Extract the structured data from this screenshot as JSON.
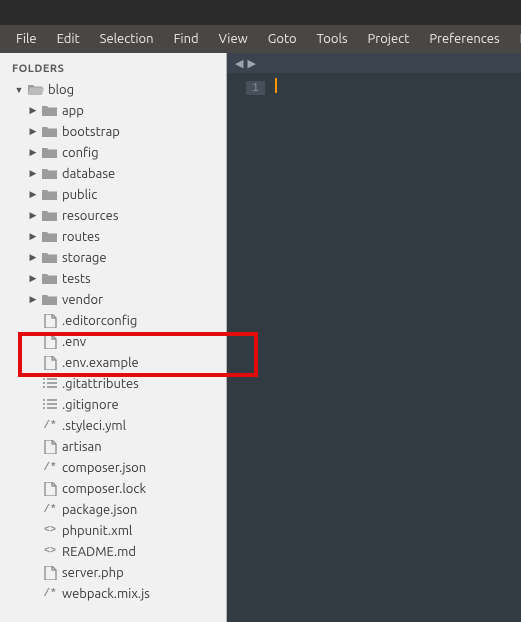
{
  "menubar": [
    "File",
    "Edit",
    "Selection",
    "Find",
    "View",
    "Goto",
    "Tools",
    "Project",
    "Preferences",
    "Help"
  ],
  "sidebar": {
    "header": "FOLDERS",
    "root": {
      "label": "blog",
      "expanded": true
    },
    "folders": [
      {
        "label": "app"
      },
      {
        "label": "bootstrap"
      },
      {
        "label": "config"
      },
      {
        "label": "database"
      },
      {
        "label": "public"
      },
      {
        "label": "resources"
      },
      {
        "label": "routes"
      },
      {
        "label": "storage"
      },
      {
        "label": "tests"
      },
      {
        "label": "vendor"
      }
    ],
    "files": [
      {
        "label": ".editorconfig",
        "icon": "file"
      },
      {
        "label": ".env",
        "icon": "file"
      },
      {
        "label": ".env.example",
        "icon": "file"
      },
      {
        "label": ".gitattributes",
        "icon": "list"
      },
      {
        "label": ".gitignore",
        "icon": "list"
      },
      {
        "label": ".styleci.yml",
        "icon": "code-comment"
      },
      {
        "label": "artisan",
        "icon": "file"
      },
      {
        "label": "composer.json",
        "icon": "code-comment"
      },
      {
        "label": "composer.lock",
        "icon": "file"
      },
      {
        "label": "package.json",
        "icon": "code-comment"
      },
      {
        "label": "phpunit.xml",
        "icon": "code-tag"
      },
      {
        "label": "README.md",
        "icon": "code-tag"
      },
      {
        "label": "server.php",
        "icon": "file"
      },
      {
        "label": "webpack.mix.js",
        "icon": "code-comment"
      }
    ]
  },
  "editor": {
    "tab_nav": {
      "prev": "◀",
      "next": "▶"
    },
    "gutter": {
      "line1": "1"
    }
  }
}
